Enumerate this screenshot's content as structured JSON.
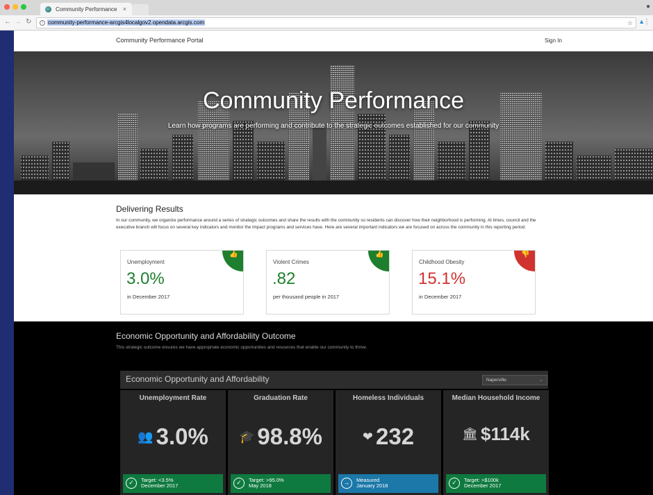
{
  "browser": {
    "tab_title": "Community Performance",
    "tab_close": "×",
    "url": "community-performance-arcgis4localgov2.opendata.arcgis.com",
    "icons": [
      "back-icon",
      "forward-icon",
      "reload-icon",
      "info-icon",
      "star-icon",
      "extension-icon",
      "menu-icon",
      "profile-icon"
    ]
  },
  "header": {
    "site_title": "Community Performance Portal",
    "sign_in": "Sign In"
  },
  "hero": {
    "title": "Community Performance",
    "subtitle": "Learn how programs are performing and contribute to the strategic outcomes established for our community"
  },
  "results": {
    "title": "Delivering Results",
    "text": "In our community, we organize performance around a series of strategic outcomes and share the results with the community so residents can discover how their neighborhood is performing. At times, council and the executive branch will focus on several key indicators and monitor the impact programs and services have. Here are several important indicators we are focused on across the community in this reporting period.",
    "cards": [
      {
        "label": "Unemployment",
        "value": "3.0%",
        "note": "in December 2017",
        "status": "good",
        "icon": "thumbs-up-icon",
        "color": "#1e7f2e"
      },
      {
        "label": "Violent Crimes",
        "value": ".82",
        "note": "per thousand people in 2017",
        "status": "good",
        "icon": "thumbs-up-icon",
        "color": "#1e7f2e"
      },
      {
        "label": "Childhood Obesity",
        "value": "15.1%",
        "note": "in December 2017",
        "status": "bad",
        "icon": "thumbs-down-icon",
        "color": "#d0332f"
      }
    ]
  },
  "outcome": {
    "title": "Economic Opportunity and Affordability Outcome",
    "text": "This strategic outcome ensures we have appropriate economic opportunities and resources that enable our community to thrive.",
    "panel_title": "Economic Opportunity and Affordability",
    "select_value": "Naperville",
    "metrics": [
      {
        "label": "Unemployment Rate",
        "value": "3.0%",
        "icon": "people-icon",
        "badge_line1": "Target: <3.5%",
        "badge_line2": "December 2017",
        "badge_icon": "check-icon",
        "badge_color": "#0f7a3f"
      },
      {
        "label": "Graduation Rate",
        "value": "98.8%",
        "icon": "graduation-cap-icon",
        "badge_line1": "Target: >95.0%",
        "badge_line2": "May 2018",
        "badge_icon": "check-icon",
        "badge_color": "#0f7a3f"
      },
      {
        "label": "Homeless Individuals",
        "value": "232",
        "icon": "hand-heart-icon",
        "badge_line1": "Measured",
        "badge_line2": "January 2018",
        "badge_icon": "arrow-right-icon",
        "badge_color": "#1b78a8"
      },
      {
        "label": "Median Household Income",
        "value": "$114k",
        "icon": "bank-icon",
        "badge_line1": "Target: >$100k",
        "badge_line2": "December 2017",
        "badge_icon": "check-icon",
        "badge_color": "#0f7a3f"
      }
    ]
  }
}
